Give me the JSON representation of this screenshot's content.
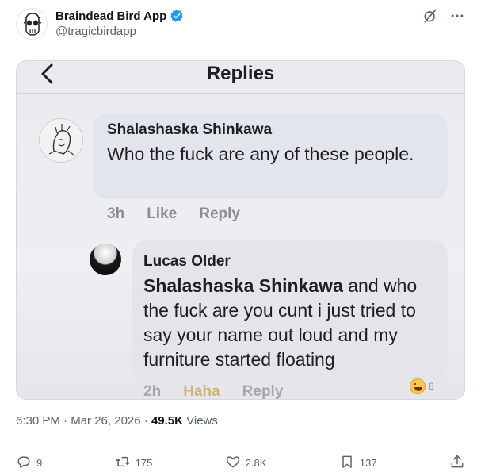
{
  "author": {
    "display_name": "Braindead Bird App",
    "handle": "@tragicbirdapp",
    "verified": true
  },
  "top_icons": [
    "grok-slash-icon",
    "more-dots-icon"
  ],
  "media": {
    "title": "Replies",
    "comments": [
      {
        "name": "Shalashaska Shinkawa",
        "text": "Who the fuck are any of these people.",
        "time": "3h",
        "like_label": "Like",
        "reply_label": "Reply"
      },
      {
        "name": "Lucas Older",
        "mention": "Shalashaska Shinkawa",
        "text": " and who the fuck are you cunt i just tried to say your name out loud and my furniture started floating",
        "time": "2h",
        "haha_label": "Haha",
        "reply_label": "Reply",
        "reaction_count": "8"
      }
    ]
  },
  "meta": {
    "time": "6:30 PM",
    "separator": " · ",
    "date": "Mar 26, 2026",
    "views_count": "49.5K",
    "views_label": " Views"
  },
  "actions": {
    "replies": "9",
    "reposts": "175",
    "likes": "2.8K",
    "bookmarks": "137"
  },
  "colors": {
    "verified_blue": "#1d9bf0",
    "secondary_text": "#536471"
  }
}
